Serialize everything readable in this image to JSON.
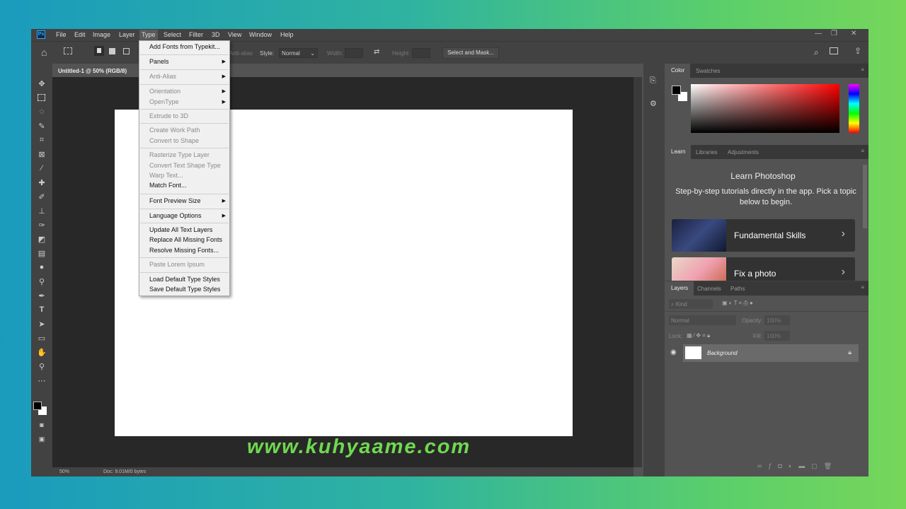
{
  "menubar": {
    "logo": "Ps",
    "items": [
      "File",
      "Edit",
      "Image",
      "Layer",
      "Type",
      "Select",
      "Filter",
      "3D",
      "View",
      "Window",
      "Help"
    ],
    "active": "Type"
  },
  "options": {
    "anti_alias": "Anti-alias",
    "style_label": "Style:",
    "style_value": "Normal",
    "width_label": "Width:",
    "height_label": "Height:",
    "select_mask": "Select and Mask..."
  },
  "document": {
    "tab": "Untitled-1 @ 50% (RGB/8)",
    "zoom": "50%",
    "doc_info": "Doc: 9.01M/0 bytes"
  },
  "type_menu": {
    "items": [
      {
        "label": "Add Fonts from Typekit...",
        "enabled": true,
        "submenu": false
      },
      {
        "label": "Panels",
        "enabled": true,
        "submenu": true
      },
      {
        "label": "Anti-Alias",
        "enabled": false,
        "submenu": true
      },
      {
        "label": "Orientation",
        "enabled": false,
        "submenu": true
      },
      {
        "label": "OpenType",
        "enabled": false,
        "submenu": true
      },
      {
        "label": "Extrude to 3D",
        "enabled": false,
        "submenu": false
      },
      {
        "label": "Create Work Path",
        "enabled": false,
        "submenu": false
      },
      {
        "label": "Convert to Shape",
        "enabled": false,
        "submenu": false
      },
      {
        "label": "Rasterize Type Layer",
        "enabled": false,
        "submenu": false
      },
      {
        "label": "Convert Text Shape Type",
        "enabled": false,
        "submenu": false
      },
      {
        "label": "Warp Text...",
        "enabled": false,
        "submenu": false
      },
      {
        "label": "Match Font...",
        "enabled": true,
        "submenu": false
      },
      {
        "label": "Font Preview Size",
        "enabled": true,
        "submenu": true
      },
      {
        "label": "Language Options",
        "enabled": true,
        "submenu": true
      },
      {
        "label": "Update All Text Layers",
        "enabled": true,
        "submenu": false
      },
      {
        "label": "Replace All Missing Fonts",
        "enabled": true,
        "submenu": false
      },
      {
        "label": "Resolve Missing Fonts...",
        "enabled": true,
        "submenu": false
      },
      {
        "label": "Paste Lorem Ipsum",
        "enabled": false,
        "submenu": false
      },
      {
        "label": "Load Default Type Styles",
        "enabled": true,
        "submenu": false
      },
      {
        "label": "Save Default Type Styles",
        "enabled": true,
        "submenu": false
      }
    ]
  },
  "color_panel": {
    "tabs": [
      "Color",
      "Swatches"
    ],
    "foreground": "#000000",
    "background": "#ffffff"
  },
  "learn_panel": {
    "tabs": [
      "Learn",
      "Libraries",
      "Adjustments"
    ],
    "title": "Learn Photoshop",
    "subtitle": "Step-by-step tutorials directly in the app. Pick a topic below to begin.",
    "cards": [
      "Fundamental Skills",
      "Fix a photo"
    ]
  },
  "layers_panel": {
    "tabs": [
      "Layers",
      "Channels",
      "Paths"
    ],
    "kind": "Kind",
    "blend": "Normal",
    "opacity_label": "Opacity:",
    "opacity": "100%",
    "lock_label": "Lock:",
    "fill_label": "Fill:",
    "fill": "100%",
    "layers": [
      {
        "name": "Background",
        "visible": true,
        "locked": true
      }
    ]
  },
  "watermark": "www.kuhyaame.com"
}
